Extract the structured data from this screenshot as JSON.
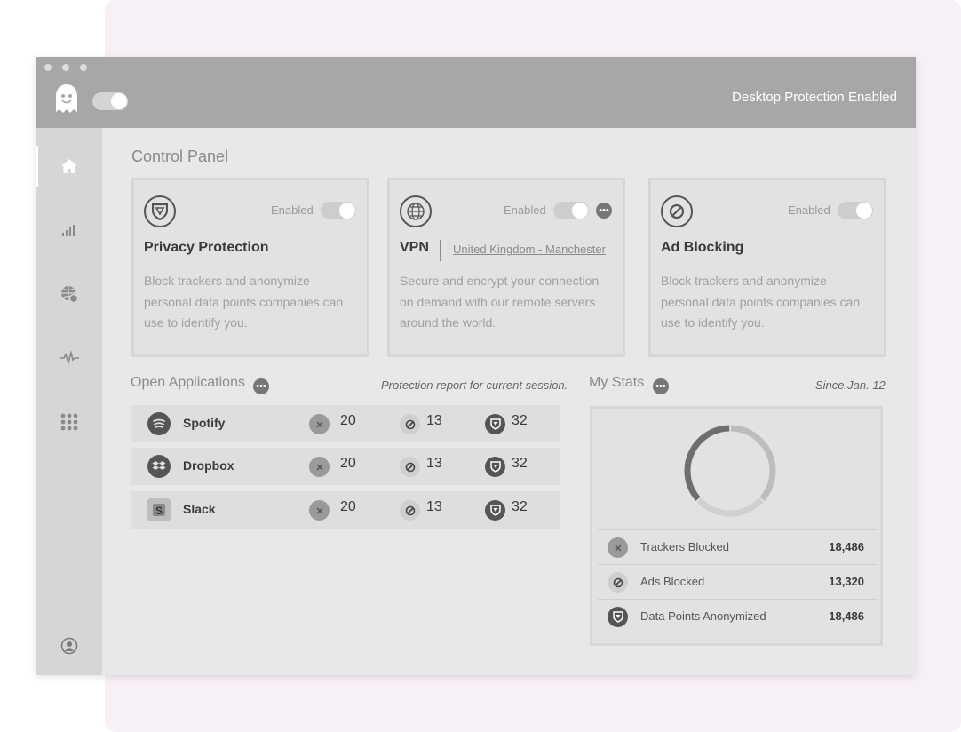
{
  "header": {
    "status": "Desktop Protection Enabled"
  },
  "page_title": "Control Panel",
  "cards": [
    {
      "icon": "shield-icon",
      "title": "Privacy Protection",
      "enabled_label": "Enabled",
      "description": "Block trackers and anonymize personal data points companies can use to identify you."
    },
    {
      "icon": "globe-icon",
      "title": "VPN",
      "location": "United Kingdom - Manchester",
      "enabled_label": "Enabled",
      "description": "Secure and encrypt your connection on demand with our remote servers around the world."
    },
    {
      "icon": "ban-icon",
      "title": "Ad Blocking",
      "enabled_label": "Enabled",
      "description": "Block trackers and anonymize personal data points companies can use to identify you."
    }
  ],
  "open_apps": {
    "title": "Open Applications",
    "note": "Protection report for current session.",
    "rows": [
      {
        "name": "Spotify",
        "icon": "spotify-icon",
        "trackers": "20",
        "ads": "13",
        "data_points": "32"
      },
      {
        "name": "Dropbox",
        "icon": "dropbox-icon",
        "trackers": "20",
        "ads": "13",
        "data_points": "32"
      },
      {
        "name": "Slack",
        "icon": "slack-icon",
        "trackers": "20",
        "ads": "13",
        "data_points": "32"
      }
    ]
  },
  "my_stats": {
    "title": "My Stats",
    "since": "Since Jan. 12",
    "rows": [
      {
        "label": "Trackers Blocked",
        "value": "18,486",
        "icon": "x-icon"
      },
      {
        "label": "Ads Blocked",
        "value": "13,320",
        "icon": "ban-icon"
      },
      {
        "label": "Data Points Anonymized",
        "value": "18,486",
        "icon": "shield-icon"
      }
    ],
    "donut": [
      {
        "label": "Trackers Blocked",
        "value": 18486,
        "color": "#bdbdbd"
      },
      {
        "label": "Ads Blocked",
        "value": 13320,
        "color": "#d0d0d0"
      },
      {
        "label": "Data Points Anonymized",
        "value": 18486,
        "color": "#6e6e6e"
      }
    ]
  }
}
